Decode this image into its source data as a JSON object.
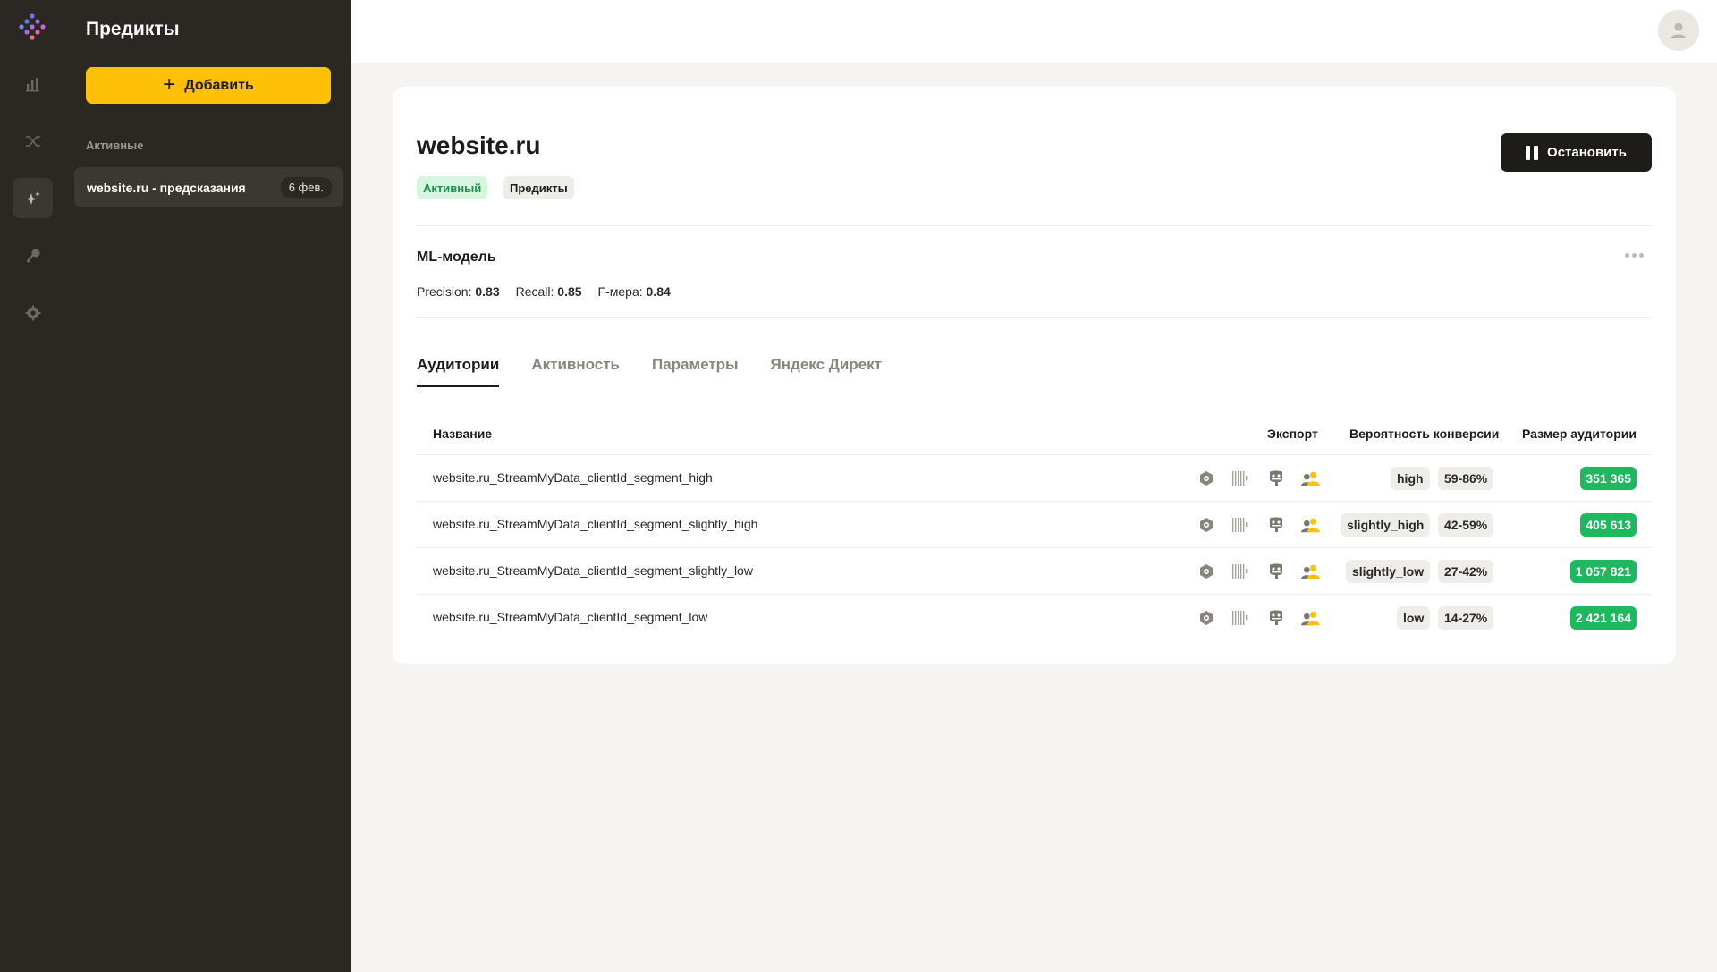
{
  "app": {
    "nav": [
      {
        "name": "analytics",
        "icon": "bar-chart-icon"
      },
      {
        "name": "integrations",
        "icon": "merge-icon"
      },
      {
        "name": "predicts",
        "icon": "sparkles-icon"
      },
      {
        "name": "keys",
        "icon": "key-icon"
      },
      {
        "name": "settings",
        "icon": "gear-icon"
      }
    ]
  },
  "sidebar": {
    "title": "Предикты",
    "add_label": "Добавить",
    "section_label": "Активные",
    "items": [
      {
        "name": "website.ru - предсказания",
        "date": "6 фев."
      }
    ]
  },
  "page": {
    "title": "website.ru",
    "status_tag": "Активный",
    "type_tag": "Предикты",
    "stop_label": "Остановить"
  },
  "model": {
    "title": "ML-модель",
    "precision_label": "Precision:",
    "precision": "0.83",
    "recall_label": "Recall:",
    "recall": "0.85",
    "f_label": "F-мера:",
    "f": "0.84"
  },
  "tabs": [
    {
      "label": "Аудитории",
      "active": true
    },
    {
      "label": "Активность",
      "active": false
    },
    {
      "label": "Параметры",
      "active": false
    },
    {
      "label": "Яндекс Директ",
      "active": false
    }
  ],
  "table": {
    "columns": {
      "name": "Название",
      "export": "Экспорт",
      "probability": "Вероятность конверсии",
      "size": "Размер аудитории"
    },
    "rows": [
      {
        "name": "website.ru_StreamMyData_clientId_segment_high",
        "segment": "high",
        "range": "59-86%",
        "size": "351 365"
      },
      {
        "name": "website.ru_StreamMyData_clientId_segment_slightly_high",
        "segment": "slightly_high",
        "range": "42-59%",
        "size": "405 613"
      },
      {
        "name": "website.ru_StreamMyData_clientId_segment_slightly_low",
        "segment": "slightly_low",
        "range": "27-42%",
        "size": "1 057 821"
      },
      {
        "name": "website.ru_StreamMyData_clientId_segment_low",
        "segment": "low",
        "range": "14-27%",
        "size": "2 421 164"
      }
    ]
  },
  "colors": {
    "sidebar_bg": "#2b2823",
    "accent_yellow": "#ffc107",
    "status_green": "#1eb85f",
    "dark_button": "#1e1c19"
  }
}
